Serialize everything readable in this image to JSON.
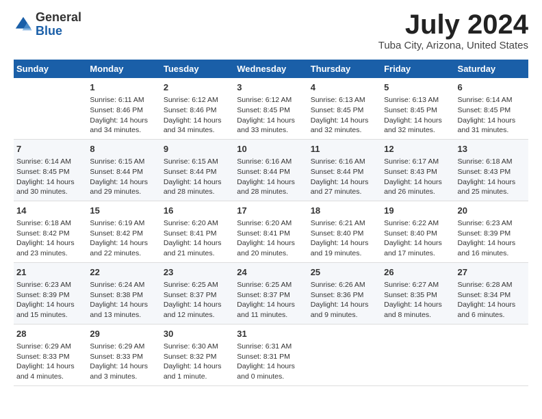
{
  "logo": {
    "general": "General",
    "blue": "Blue"
  },
  "title": "July 2024",
  "location": "Tuba City, Arizona, United States",
  "days_of_week": [
    "Sunday",
    "Monday",
    "Tuesday",
    "Wednesday",
    "Thursday",
    "Friday",
    "Saturday"
  ],
  "weeks": [
    [
      {
        "day": "",
        "sunrise": "",
        "sunset": "",
        "daylight": ""
      },
      {
        "day": "1",
        "sunrise": "Sunrise: 6:11 AM",
        "sunset": "Sunset: 8:46 PM",
        "daylight": "Daylight: 14 hours and 34 minutes."
      },
      {
        "day": "2",
        "sunrise": "Sunrise: 6:12 AM",
        "sunset": "Sunset: 8:46 PM",
        "daylight": "Daylight: 14 hours and 34 minutes."
      },
      {
        "day": "3",
        "sunrise": "Sunrise: 6:12 AM",
        "sunset": "Sunset: 8:45 PM",
        "daylight": "Daylight: 14 hours and 33 minutes."
      },
      {
        "day": "4",
        "sunrise": "Sunrise: 6:13 AM",
        "sunset": "Sunset: 8:45 PM",
        "daylight": "Daylight: 14 hours and 32 minutes."
      },
      {
        "day": "5",
        "sunrise": "Sunrise: 6:13 AM",
        "sunset": "Sunset: 8:45 PM",
        "daylight": "Daylight: 14 hours and 32 minutes."
      },
      {
        "day": "6",
        "sunrise": "Sunrise: 6:14 AM",
        "sunset": "Sunset: 8:45 PM",
        "daylight": "Daylight: 14 hours and 31 minutes."
      }
    ],
    [
      {
        "day": "7",
        "sunrise": "Sunrise: 6:14 AM",
        "sunset": "Sunset: 8:45 PM",
        "daylight": "Daylight: 14 hours and 30 minutes."
      },
      {
        "day": "8",
        "sunrise": "Sunrise: 6:15 AM",
        "sunset": "Sunset: 8:44 PM",
        "daylight": "Daylight: 14 hours and 29 minutes."
      },
      {
        "day": "9",
        "sunrise": "Sunrise: 6:15 AM",
        "sunset": "Sunset: 8:44 PM",
        "daylight": "Daylight: 14 hours and 28 minutes."
      },
      {
        "day": "10",
        "sunrise": "Sunrise: 6:16 AM",
        "sunset": "Sunset: 8:44 PM",
        "daylight": "Daylight: 14 hours and 28 minutes."
      },
      {
        "day": "11",
        "sunrise": "Sunrise: 6:16 AM",
        "sunset": "Sunset: 8:44 PM",
        "daylight": "Daylight: 14 hours and 27 minutes."
      },
      {
        "day": "12",
        "sunrise": "Sunrise: 6:17 AM",
        "sunset": "Sunset: 8:43 PM",
        "daylight": "Daylight: 14 hours and 26 minutes."
      },
      {
        "day": "13",
        "sunrise": "Sunrise: 6:18 AM",
        "sunset": "Sunset: 8:43 PM",
        "daylight": "Daylight: 14 hours and 25 minutes."
      }
    ],
    [
      {
        "day": "14",
        "sunrise": "Sunrise: 6:18 AM",
        "sunset": "Sunset: 8:42 PM",
        "daylight": "Daylight: 14 hours and 23 minutes."
      },
      {
        "day": "15",
        "sunrise": "Sunrise: 6:19 AM",
        "sunset": "Sunset: 8:42 PM",
        "daylight": "Daylight: 14 hours and 22 minutes."
      },
      {
        "day": "16",
        "sunrise": "Sunrise: 6:20 AM",
        "sunset": "Sunset: 8:41 PM",
        "daylight": "Daylight: 14 hours and 21 minutes."
      },
      {
        "day": "17",
        "sunrise": "Sunrise: 6:20 AM",
        "sunset": "Sunset: 8:41 PM",
        "daylight": "Daylight: 14 hours and 20 minutes."
      },
      {
        "day": "18",
        "sunrise": "Sunrise: 6:21 AM",
        "sunset": "Sunset: 8:40 PM",
        "daylight": "Daylight: 14 hours and 19 minutes."
      },
      {
        "day": "19",
        "sunrise": "Sunrise: 6:22 AM",
        "sunset": "Sunset: 8:40 PM",
        "daylight": "Daylight: 14 hours and 17 minutes."
      },
      {
        "day": "20",
        "sunrise": "Sunrise: 6:23 AM",
        "sunset": "Sunset: 8:39 PM",
        "daylight": "Daylight: 14 hours and 16 minutes."
      }
    ],
    [
      {
        "day": "21",
        "sunrise": "Sunrise: 6:23 AM",
        "sunset": "Sunset: 8:39 PM",
        "daylight": "Daylight: 14 hours and 15 minutes."
      },
      {
        "day": "22",
        "sunrise": "Sunrise: 6:24 AM",
        "sunset": "Sunset: 8:38 PM",
        "daylight": "Daylight: 14 hours and 13 minutes."
      },
      {
        "day": "23",
        "sunrise": "Sunrise: 6:25 AM",
        "sunset": "Sunset: 8:37 PM",
        "daylight": "Daylight: 14 hours and 12 minutes."
      },
      {
        "day": "24",
        "sunrise": "Sunrise: 6:25 AM",
        "sunset": "Sunset: 8:37 PM",
        "daylight": "Daylight: 14 hours and 11 minutes."
      },
      {
        "day": "25",
        "sunrise": "Sunrise: 6:26 AM",
        "sunset": "Sunset: 8:36 PM",
        "daylight": "Daylight: 14 hours and 9 minutes."
      },
      {
        "day": "26",
        "sunrise": "Sunrise: 6:27 AM",
        "sunset": "Sunset: 8:35 PM",
        "daylight": "Daylight: 14 hours and 8 minutes."
      },
      {
        "day": "27",
        "sunrise": "Sunrise: 6:28 AM",
        "sunset": "Sunset: 8:34 PM",
        "daylight": "Daylight: 14 hours and 6 minutes."
      }
    ],
    [
      {
        "day": "28",
        "sunrise": "Sunrise: 6:29 AM",
        "sunset": "Sunset: 8:33 PM",
        "daylight": "Daylight: 14 hours and 4 minutes."
      },
      {
        "day": "29",
        "sunrise": "Sunrise: 6:29 AM",
        "sunset": "Sunset: 8:33 PM",
        "daylight": "Daylight: 14 hours and 3 minutes."
      },
      {
        "day": "30",
        "sunrise": "Sunrise: 6:30 AM",
        "sunset": "Sunset: 8:32 PM",
        "daylight": "Daylight: 14 hours and 1 minute."
      },
      {
        "day": "31",
        "sunrise": "Sunrise: 6:31 AM",
        "sunset": "Sunset: 8:31 PM",
        "daylight": "Daylight: 14 hours and 0 minutes."
      },
      {
        "day": "",
        "sunrise": "",
        "sunset": "",
        "daylight": ""
      },
      {
        "day": "",
        "sunrise": "",
        "sunset": "",
        "daylight": ""
      },
      {
        "day": "",
        "sunrise": "",
        "sunset": "",
        "daylight": ""
      }
    ]
  ]
}
